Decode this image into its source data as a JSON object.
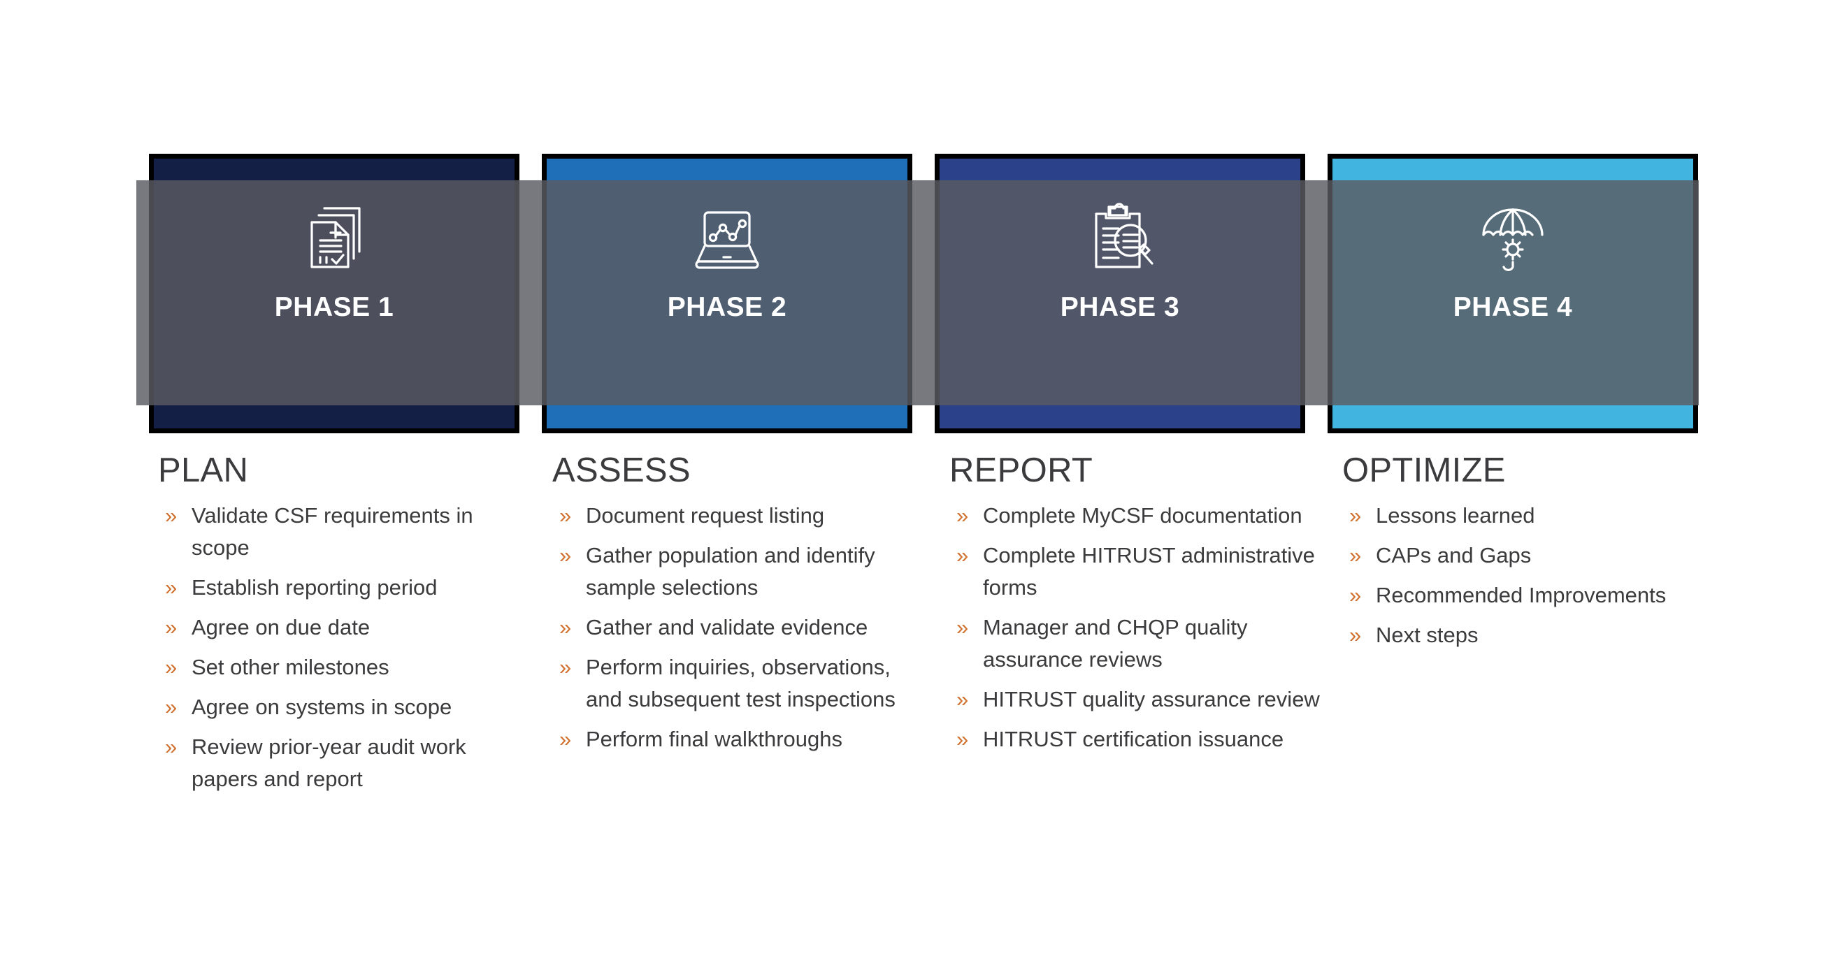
{
  "phases": [
    {
      "label": "PHASE 1",
      "band_color": "#131F45",
      "icon": "documents-checklist-icon",
      "title": "PLAN",
      "bullets": [
        "Validate CSF requirements in scope",
        "Establish reporting period",
        "Agree on due date",
        "Set other milestones",
        "Agree on systems in scope",
        "Review prior-year audit work papers and report"
      ]
    },
    {
      "label": "PHASE 2",
      "band_color": "#1F6EB8",
      "icon": "laptop-line-chart-icon",
      "title": "ASSESS",
      "bullets": [
        "Document request listing",
        "Gather population and identify sample selections",
        "Gather and validate evidence",
        "Perform inquiries, observations, and subsequent test inspections",
        "Perform final walkthroughs"
      ]
    },
    {
      "label": "PHASE 3",
      "band_color": "#2B4189",
      "icon": "clipboard-magnifier-icon",
      "title": "REPORT",
      "bullets": [
        "Complete MyCSF documentation",
        "Complete HITRUST administrative forms",
        "Manager and CHQP quality assurance reviews",
        "HITRUST quality assurance review",
        "HITRUST certification issuance"
      ]
    },
    {
      "label": "PHASE 4",
      "band_color": "#42B4E0",
      "icon": "umbrella-sun-icon",
      "title": "OPTIMIZE",
      "bullets": [
        "Lessons learned",
        "CAPs and Gaps",
        "Recommended Improvements",
        "Next steps"
      ]
    }
  ],
  "bullet_marker": "»",
  "colors": {
    "bullet_orange": "#D2712F",
    "text_dark": "#3b3b3d",
    "band_overlay_grey": "#5A5C61",
    "card_border": "#000000",
    "background": "#FFFFFF"
  }
}
